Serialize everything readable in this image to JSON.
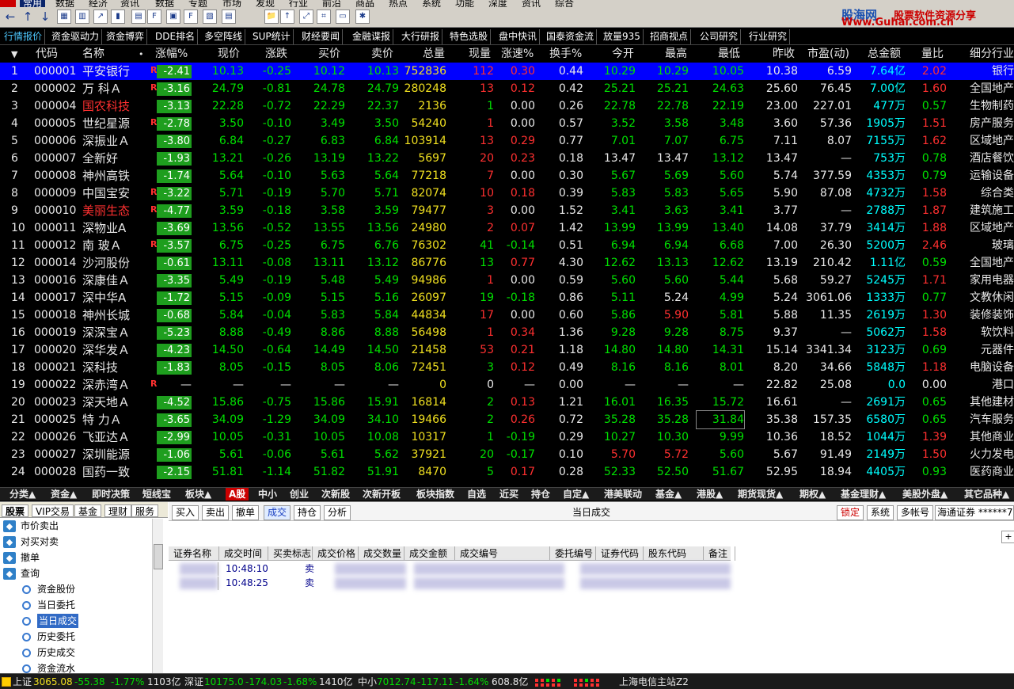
{
  "menu": [
    "常用",
    "数据",
    "经济",
    "资讯",
    "数据",
    "专题",
    "市场",
    "发现",
    "行业",
    "前沿",
    "商品",
    "热点",
    "系统",
    "功能",
    "深度",
    "资讯",
    "综合"
  ],
  "brand": {
    "name": "股海网",
    "tagline": "股票软件资源分享",
    "url": "Www.Guhai.com.cn"
  },
  "tabs": [
    "行情报价",
    "资金驱动力",
    "资金博弈",
    "DDE排名",
    "多空阵线",
    "SUP统计",
    "财经要闻",
    "金融谍报",
    "大行研报",
    "特色选股",
    "盘中快讯",
    "国泰资金流",
    "放量935",
    "招商视点",
    "公司研究",
    "行业研究"
  ],
  "headers": [
    "代码",
    "名称",
    "涨幅%",
    "现价",
    "涨跌",
    "买价",
    "卖价",
    "总量",
    "现量",
    "涨速%",
    "换手%",
    "今开",
    "最高",
    "最低",
    "昨收",
    "市盈(动)",
    "总金额",
    "量比",
    "细分行业"
  ],
  "rows": [
    [
      "1",
      "000001",
      "平安银行",
      "-2.41",
      "10.13",
      "-0.25",
      "10.12",
      "10.13",
      "752836",
      "112",
      "0.30",
      "0.44",
      "10.29",
      "10.29",
      "10.05",
      "10.38",
      "6.59",
      "7.64亿",
      "2.02",
      "银行"
    ],
    [
      "2",
      "000002",
      "万 科Ａ",
      "-3.16",
      "24.79",
      "-0.81",
      "24.78",
      "24.79",
      "280248",
      "13",
      "0.12",
      "0.42",
      "25.21",
      "25.21",
      "24.63",
      "25.60",
      "76.45",
      "7.00亿",
      "1.60",
      "全国地产"
    ],
    [
      "3",
      "000004",
      "国农科技",
      "-3.13",
      "22.28",
      "-0.72",
      "22.29",
      "22.37",
      "2136",
      "1",
      "0.00",
      "0.26",
      "22.78",
      "22.78",
      "22.19",
      "23.00",
      "227.01",
      "477万",
      "0.57",
      "生物制药"
    ],
    [
      "4",
      "000005",
      "世纪星源",
      "-2.78",
      "3.50",
      "-0.10",
      "3.49",
      "3.50",
      "54240",
      "1",
      "0.00",
      "0.57",
      "3.52",
      "3.58",
      "3.48",
      "3.60",
      "57.36",
      "1905万",
      "1.51",
      "房产服务"
    ],
    [
      "5",
      "000006",
      "深振业Ａ",
      "-3.80",
      "6.84",
      "-0.27",
      "6.83",
      "6.84",
      "103914",
      "13",
      "0.29",
      "0.77",
      "7.01",
      "7.07",
      "6.75",
      "7.11",
      "8.07",
      "7155万",
      "1.62",
      "区域地产"
    ],
    [
      "6",
      "000007",
      "全新好",
      "-1.93",
      "13.21",
      "-0.26",
      "13.19",
      "13.22",
      "5697",
      "20",
      "0.23",
      "0.18",
      "13.47",
      "13.47",
      "13.12",
      "13.47",
      "—",
      "753万",
      "0.78",
      "酒店餐饮"
    ],
    [
      "7",
      "000008",
      "神州高铁",
      "-1.74",
      "5.64",
      "-0.10",
      "5.63",
      "5.64",
      "77218",
      "7",
      "0.00",
      "0.30",
      "5.67",
      "5.69",
      "5.60",
      "5.74",
      "377.59",
      "4353万",
      "0.79",
      "运输设备"
    ],
    [
      "8",
      "000009",
      "中国宝安",
      "-3.22",
      "5.71",
      "-0.19",
      "5.70",
      "5.71",
      "82074",
      "10",
      "0.18",
      "0.39",
      "5.83",
      "5.83",
      "5.65",
      "5.90",
      "87.08",
      "4732万",
      "1.58",
      "综合类"
    ],
    [
      "9",
      "000010",
      "美丽生态",
      "-4.77",
      "3.59",
      "-0.18",
      "3.58",
      "3.59",
      "79477",
      "3",
      "0.00",
      "1.52",
      "3.41",
      "3.63",
      "3.41",
      "3.77",
      "—",
      "2788万",
      "1.87",
      "建筑施工"
    ],
    [
      "10",
      "000011",
      "深物业A",
      "-3.69",
      "13.56",
      "-0.52",
      "13.55",
      "13.56",
      "24980",
      "2",
      "0.07",
      "1.42",
      "13.99",
      "13.99",
      "13.40",
      "14.08",
      "37.79",
      "3414万",
      "1.88",
      "区域地产"
    ],
    [
      "11",
      "000012",
      "南 玻Ａ",
      "-3.57",
      "6.75",
      "-0.25",
      "6.75",
      "6.76",
      "76302",
      "41",
      "-0.14",
      "0.51",
      "6.94",
      "6.94",
      "6.68",
      "7.00",
      "26.30",
      "5200万",
      "2.46",
      "玻璃"
    ],
    [
      "12",
      "000014",
      "沙河股份",
      "-0.61",
      "13.11",
      "-0.08",
      "13.11",
      "13.12",
      "86776",
      "13",
      "0.77",
      "4.30",
      "12.62",
      "13.13",
      "12.62",
      "13.19",
      "210.42",
      "1.11亿",
      "0.59",
      "全国地产"
    ],
    [
      "13",
      "000016",
      "深康佳Ａ",
      "-3.35",
      "5.49",
      "-0.19",
      "5.48",
      "5.49",
      "94986",
      "1",
      "0.00",
      "0.59",
      "5.60",
      "5.60",
      "5.44",
      "5.68",
      "59.27",
      "5245万",
      "1.71",
      "家用电器"
    ],
    [
      "14",
      "000017",
      "深中华A",
      "-1.72",
      "5.15",
      "-0.09",
      "5.15",
      "5.16",
      "26097",
      "19",
      "-0.18",
      "0.86",
      "5.11",
      "5.24",
      "4.99",
      "5.24",
      "3061.06",
      "1333万",
      "0.77",
      "文教休闲"
    ],
    [
      "15",
      "000018",
      "神州长城",
      "-0.68",
      "5.84",
      "-0.04",
      "5.83",
      "5.84",
      "44834",
      "17",
      "0.00",
      "0.60",
      "5.86",
      "5.90",
      "5.81",
      "5.88",
      "11.35",
      "2619万",
      "1.30",
      "装修装饰"
    ],
    [
      "16",
      "000019",
      "深深宝Ａ",
      "-5.23",
      "8.88",
      "-0.49",
      "8.86",
      "8.88",
      "56498",
      "1",
      "0.34",
      "1.36",
      "9.28",
      "9.28",
      "8.75",
      "9.37",
      "—",
      "5062万",
      "1.58",
      "软饮料"
    ],
    [
      "17",
      "000020",
      "深华发Ａ",
      "-4.23",
      "14.50",
      "-0.64",
      "14.49",
      "14.50",
      "21458",
      "53",
      "0.21",
      "1.18",
      "14.80",
      "14.80",
      "14.31",
      "15.14",
      "3341.34",
      "3123万",
      "0.69",
      "元器件"
    ],
    [
      "18",
      "000021",
      "深科技",
      "-1.83",
      "8.05",
      "-0.15",
      "8.05",
      "8.06",
      "72451",
      "3",
      "0.12",
      "0.49",
      "8.16",
      "8.16",
      "8.01",
      "8.20",
      "34.66",
      "5848万",
      "1.18",
      "电脑设备"
    ],
    [
      "19",
      "000022",
      "深赤湾Ａ",
      "—",
      "—",
      "—",
      "—",
      "—",
      "0",
      "0",
      "—",
      "0.00",
      "—",
      "—",
      "—",
      "22.82",
      "25.08",
      "0.0",
      "0.00",
      "港口"
    ],
    [
      "20",
      "000023",
      "深天地Ａ",
      "-4.52",
      "15.86",
      "-0.75",
      "15.86",
      "15.91",
      "16814",
      "2",
      "0.13",
      "1.21",
      "16.01",
      "16.35",
      "15.72",
      "16.61",
      "—",
      "2691万",
      "0.65",
      "其他建材"
    ],
    [
      "21",
      "000025",
      "特 力Ａ",
      "-3.65",
      "34.09",
      "-1.29",
      "34.09",
      "34.10",
      "19466",
      "2",
      "0.26",
      "0.72",
      "35.28",
      "35.28",
      "31.84",
      "35.38",
      "157.35",
      "6580万",
      "0.65",
      "汽车服务"
    ],
    [
      "22",
      "000026",
      "飞亚达Ａ",
      "-2.99",
      "10.05",
      "-0.31",
      "10.05",
      "10.08",
      "10317",
      "1",
      "-0.19",
      "0.29",
      "10.27",
      "10.30",
      "9.99",
      "10.36",
      "18.52",
      "1044万",
      "1.39",
      "其他商业"
    ],
    [
      "23",
      "000027",
      "深圳能源",
      "-1.06",
      "5.61",
      "-0.06",
      "5.61",
      "5.62",
      "37921",
      "20",
      "-0.17",
      "0.10",
      "5.70",
      "5.72",
      "5.60",
      "5.67",
      "91.49",
      "2149万",
      "1.50",
      "火力发电"
    ],
    [
      "24",
      "000028",
      "国药一致",
      "-2.15",
      "51.81",
      "-1.14",
      "51.82",
      "51.91",
      "8470",
      "5",
      "0.17",
      "0.28",
      "52.33",
      "52.50",
      "51.67",
      "52.95",
      "18.94",
      "4405万",
      "0.93",
      "医药商业"
    ]
  ],
  "r_marks": [
    "1",
    "2",
    "4",
    "8",
    "9",
    "11",
    "19"
  ],
  "categories": [
    "分类▲",
    "资金▲",
    "即时决策",
    "短线宝",
    "板块▲",
    "A股",
    "中小",
    "创业",
    "次新股",
    "次新开板",
    "板块指数",
    "自选",
    "近买",
    "持仓",
    "自定▲",
    "港美联动",
    "基金▲",
    "港股▲",
    "期货现货▲",
    "期权▲",
    "基金理财▲",
    "美股外盘▲",
    "其它品种▲"
  ],
  "trade": {
    "left_tabs": [
      "股票",
      "VIP交易",
      "基金",
      "理财",
      "服务"
    ],
    "tree": [
      "市价卖出",
      "对买对卖",
      "撤单",
      "查询",
      "资金股份",
      "当日委托",
      "当日成交",
      "历史委托",
      "历史成交",
      "资金流水"
    ],
    "buttons": [
      "买入",
      "卖出",
      "撤单",
      "成交",
      "持仓",
      "分析"
    ],
    "title": "当日成交",
    "right_buttons": [
      "锁定",
      "系统",
      "多帐号"
    ],
    "account": "海通证券 ******7",
    "columns": [
      "证券名称",
      "成交时间",
      "买卖标志",
      "成交价格",
      "成交数量",
      "成交金额",
      "成交编号",
      "委托编号",
      "证券代码",
      "股东代码",
      "备注"
    ],
    "rows": [
      {
        "time": "10:48:10",
        "side": "卖"
      },
      {
        "time": "10:48:25",
        "side": "卖"
      }
    ]
  },
  "status": {
    "sh_label": "上证",
    "sh_val": "3065.08",
    "sh_chg": "-55.38",
    "sh_pct": "-1.77%",
    "sh_amt": "1103亿",
    "sz_label": "深证",
    "sz_val": "10175.0",
    "sz_chg": "-174.03",
    "sz_pct": "-1.68%",
    "sz_amt": "1410亿",
    "zx_label": "中小",
    "zx_val": "7012.74",
    "zx_chg": "-117.11",
    "zx_pct": "-1.64%",
    "zx_amt": "608.8亿",
    "server": "上海电信主站Z2"
  }
}
